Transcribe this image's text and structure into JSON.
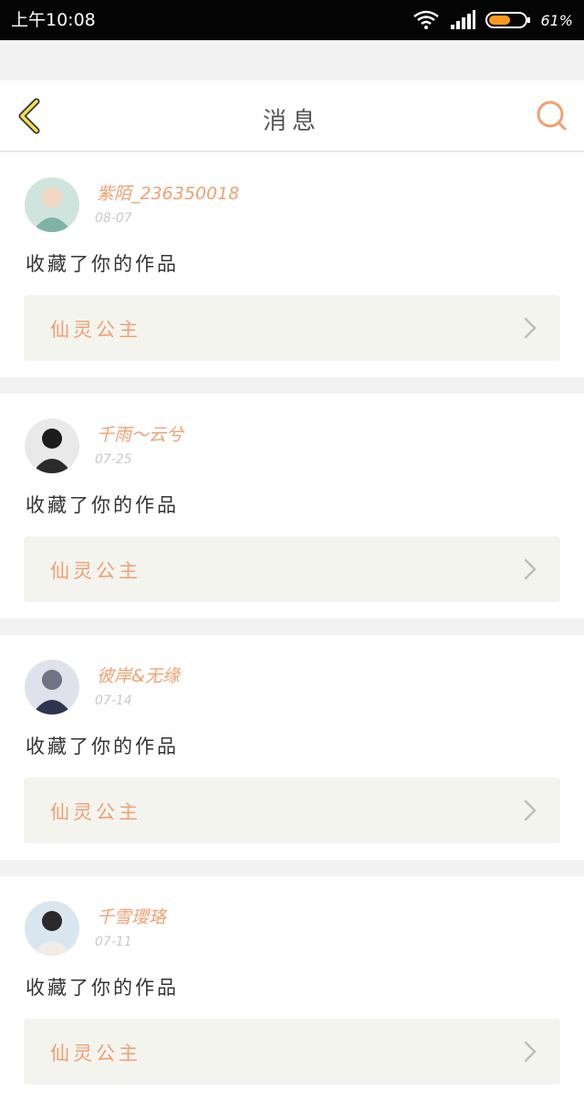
{
  "status_bar": {
    "time": "上午10:08",
    "battery_percent": "61%",
    "battery_level": 0.61,
    "icons": [
      "wifi-icon",
      "signal-icon",
      "battery-icon"
    ]
  },
  "header": {
    "title": "消息",
    "back_icon": "chevron-left-icon",
    "search_icon": "search-icon",
    "accent_color": "#f0a070"
  },
  "messages": [
    {
      "user": "紫陌_236350018",
      "date": "08-07",
      "action": "收藏了你的作品",
      "work": "仙灵公主"
    },
    {
      "user": "千雨～云兮",
      "date": "07-25",
      "action": "收藏了你的作品",
      "work": "仙灵公主"
    },
    {
      "user": "彼岸&无缘",
      "date": "07-14",
      "action": "收藏了你的作品",
      "work": "仙灵公主"
    },
    {
      "user": "千雪瓔珞",
      "date": "07-11",
      "action": "收藏了你的作品",
      "work": "仙灵公主"
    }
  ]
}
